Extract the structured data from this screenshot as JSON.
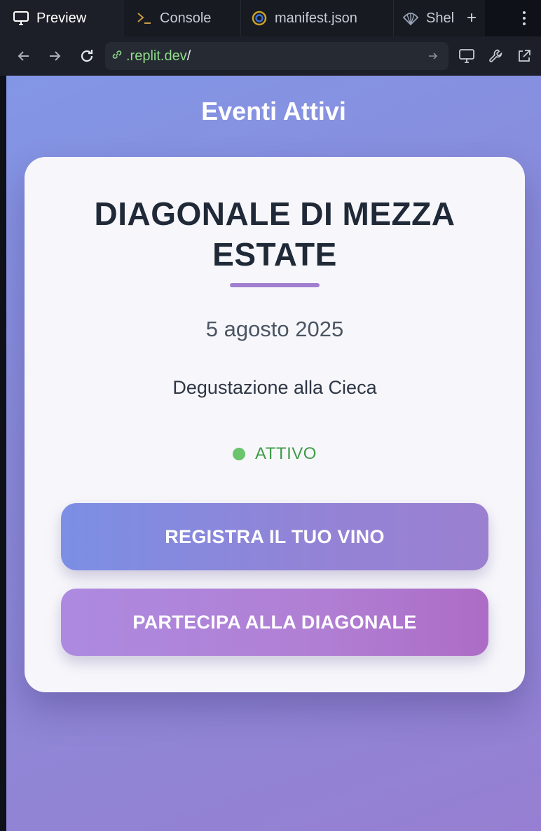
{
  "tabs": [
    {
      "label": "Preview",
      "icon": "monitor-icon",
      "active": true
    },
    {
      "label": "Console",
      "icon": "terminal-prompt-icon",
      "active": false
    },
    {
      "label": "manifest.json",
      "icon": "json-file-icon",
      "active": false
    },
    {
      "label": "Shel",
      "icon": "shell-icon",
      "active": false
    }
  ],
  "tab_controls": {
    "add": "+"
  },
  "urlbar": {
    "url_domain": ".replit.dev",
    "url_path": "/"
  },
  "page": {
    "heading": "Eventi Attivi",
    "event": {
      "title": "DIAGONALE DI MEZZA ESTATE",
      "date": "5 agosto 2025",
      "type": "Degustazione alla Cieca",
      "status": "ATTIVO"
    },
    "buttons": {
      "register": "REGISTRA IL TUO VINO",
      "join": "PARTECIPA ALLA DIAGONALE"
    }
  },
  "colors": {
    "accent_underline": "#a07fcf",
    "status_green": "#3f9c48",
    "url_green": "#8fdc8a"
  }
}
